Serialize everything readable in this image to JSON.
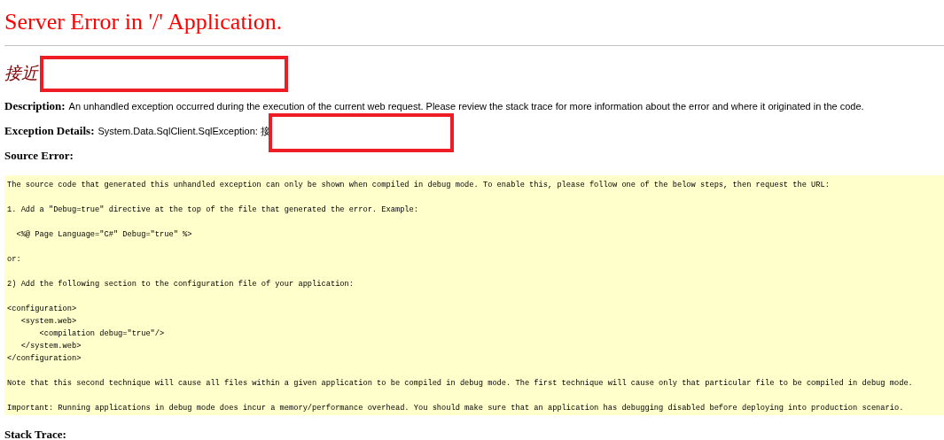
{
  "title": "Server Error in '/' Application.",
  "subtitle": {
    "text": "接近",
    "redacted": true
  },
  "description": {
    "label": "Description:",
    "text": "An unhandled exception occurred during the execution of the current web request. Please review the stack trace for more information about the error and where it originated in the code."
  },
  "exception_details": {
    "label": "Exception Details:",
    "text": "System.Data.SqlClient.SqlException: 接",
    "redacted": true
  },
  "source_error": {
    "label": "Source Error:",
    "code_paragraphs": [
      [
        "The source code that generated this unhandled exception can only be shown when compiled in debug mode. To enable this, please follow one of the below steps, then request the URL:"
      ],
      [
        "1. Add a \"Debug=true\" directive at the top of the file that generated the error. Example:"
      ],
      [
        "  <%@ Page Language=\"C#\" Debug=\"true\" %>"
      ],
      [
        "or:"
      ],
      [
        "2) Add the following section to the configuration file of your application:"
      ],
      [
        "<configuration>",
        "   <system.web>",
        "       <compilation debug=\"true\"/>",
        "   </system.web>",
        "</configuration>"
      ],
      [
        "Note that this second technique will cause all files within a given application to be compiled in debug mode. The first technique will cause only that particular file to be compiled in debug mode."
      ],
      [
        "Important: Running applications in debug mode does incur a memory/performance overhead. You should make sure that an application has debugging disabled before deploying into production scenario."
      ]
    ]
  },
  "stack_trace": {
    "label": "Stack Trace:"
  }
}
